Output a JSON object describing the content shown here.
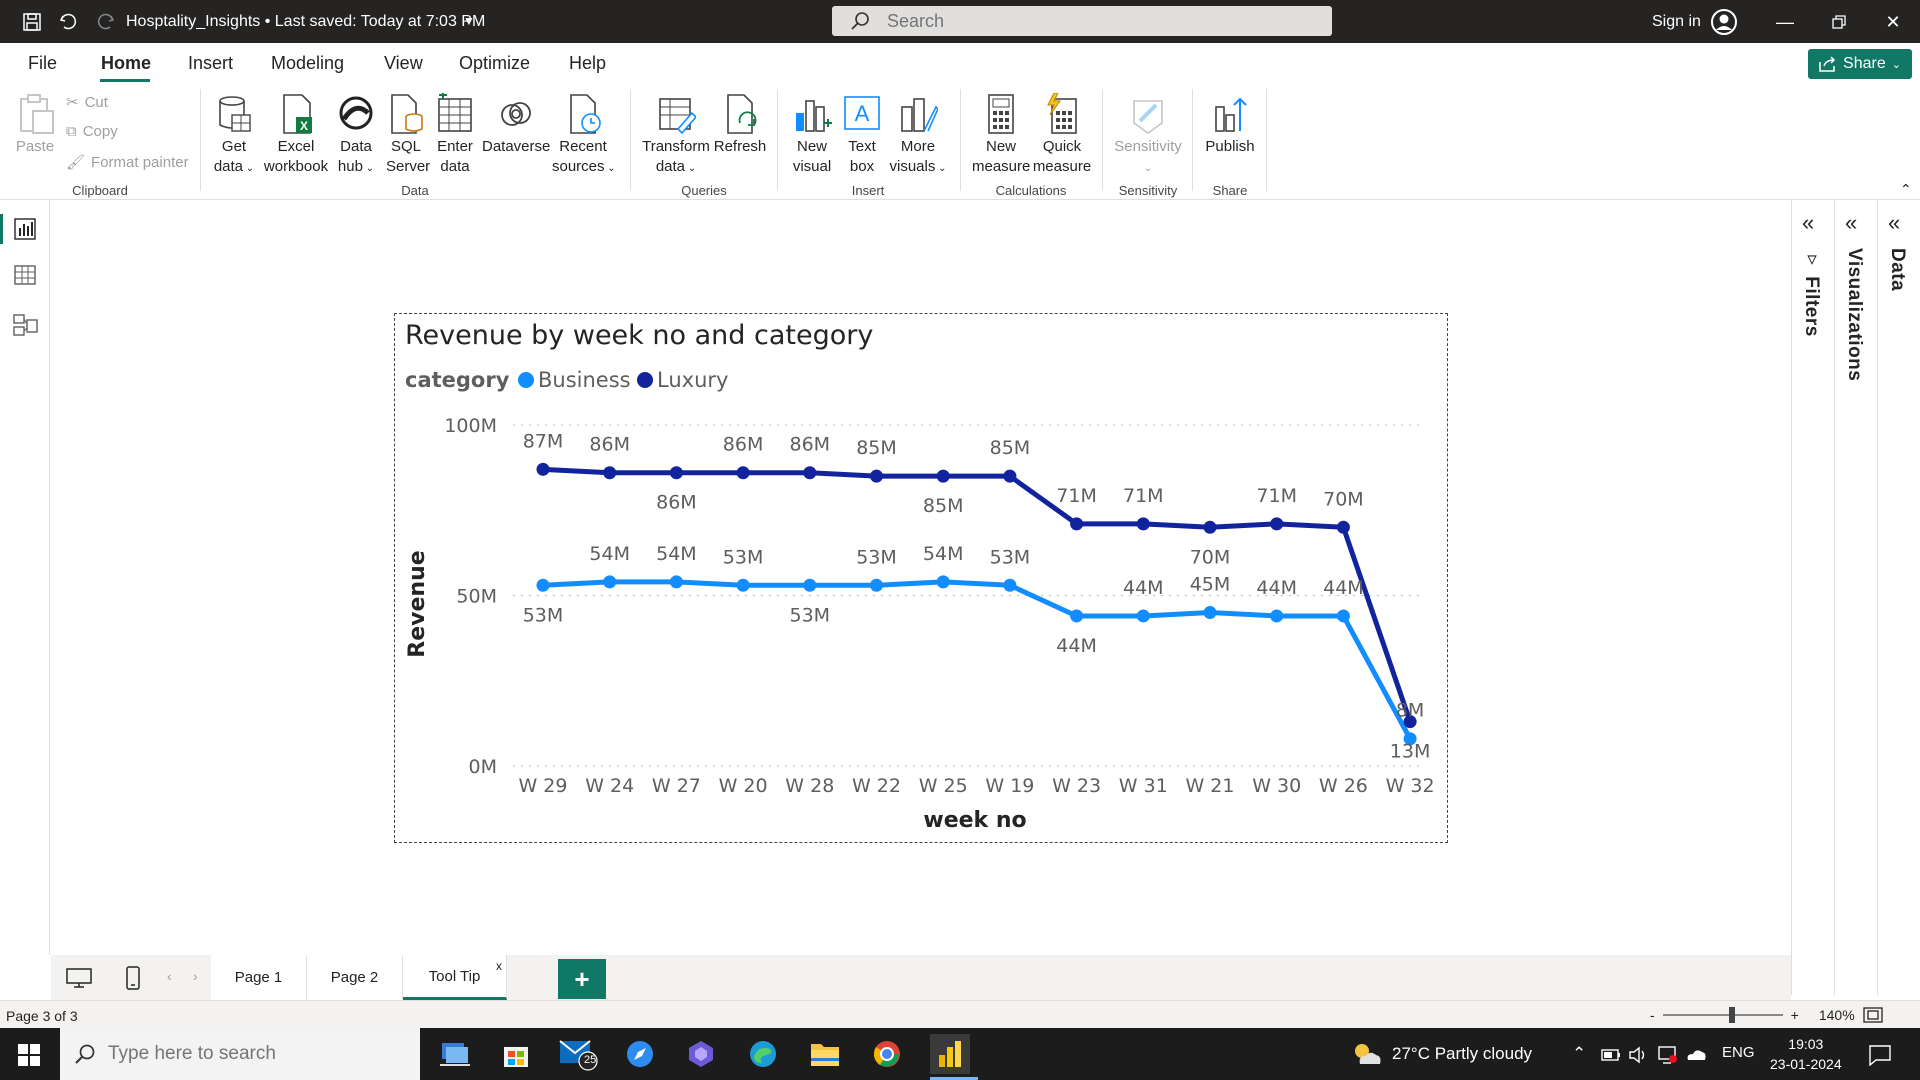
{
  "titlebar": {
    "file_title": "Hosptality_Insights • Last saved: Today at 7:03 PM",
    "search_placeholder": "Search",
    "signin": "Sign in"
  },
  "menu": {
    "tabs": [
      "File",
      "Home",
      "Insert",
      "Modeling",
      "View",
      "Optimize",
      "Help"
    ],
    "active": "Home",
    "share": "Share"
  },
  "ribbon": {
    "clipboard": {
      "paste": "Paste",
      "cut": "Cut",
      "copy": "Copy",
      "format_painter": "Format painter",
      "label": "Clipboard"
    },
    "data": {
      "get_data": [
        "Get",
        "data"
      ],
      "excel": [
        "Excel",
        "workbook"
      ],
      "data_hub": [
        "Data",
        "hub"
      ],
      "sql": [
        "SQL",
        "Server"
      ],
      "enter_data": [
        "Enter",
        "data"
      ],
      "dataverse": "Dataverse",
      "recent": [
        "Recent",
        "sources"
      ],
      "label": "Data"
    },
    "queries": {
      "transform": [
        "Transform",
        "data"
      ],
      "refresh": "Refresh",
      "label": "Queries"
    },
    "insert": {
      "new_visual": [
        "New",
        "visual"
      ],
      "text_box": [
        "Text",
        "box"
      ],
      "more_visuals": [
        "More",
        "visuals"
      ],
      "label": "Insert"
    },
    "calculations": {
      "new_measure": [
        "New",
        "measure"
      ],
      "quick_measure": [
        "Quick",
        "measure"
      ],
      "label": "Calculations"
    },
    "sensitivity": {
      "button": "Sensitivity",
      "label": "Sensitivity"
    },
    "share": {
      "publish": "Publish",
      "label": "Share"
    }
  },
  "panes": {
    "filters": "Filters",
    "visualizations": "Visualizations",
    "data": "Data"
  },
  "pages": {
    "tabs": [
      "Page 1",
      "Page 2",
      "Tool Tip"
    ],
    "active": "Tool Tip",
    "close": "x",
    "add": "+"
  },
  "status": {
    "page_text": "Page 3 of 3",
    "zoom": "140%",
    "zoom_minus": "-",
    "zoom_plus": "+"
  },
  "taskbar": {
    "search_placeholder": "Type here to search",
    "mail_badge": "25",
    "weather": "27°C  Partly cloudy",
    "lang": "ENG",
    "time": "19:03",
    "date": "23-01-2024"
  },
  "colors": {
    "accent": "#117865",
    "business": "#118dff",
    "luxury": "#12239e"
  },
  "chart_data": {
    "type": "line",
    "title": "Revenue by week no and category",
    "legend_title": "category",
    "legend_position": "top-left",
    "xlabel": "week no",
    "ylabel": "Revenue",
    "ylim": [
      0,
      100
    ],
    "y_ticks": [
      "0M",
      "50M",
      "100M"
    ],
    "categories": [
      "W 29",
      "W 24",
      "W 27",
      "W 20",
      "W 28",
      "W 22",
      "W 25",
      "W 19",
      "W 23",
      "W 31",
      "W 21",
      "W 30",
      "W 26",
      "W 32"
    ],
    "series": [
      {
        "name": "Business",
        "color": "#118dff",
        "values": [
          53,
          54,
          54,
          53,
          53,
          53,
          54,
          53,
          44,
          44,
          45,
          44,
          44,
          8
        ],
        "labels": [
          "53M",
          "54M",
          "54M",
          "53M",
          "53M",
          "53M",
          "54M",
          "53M",
          "44M",
          "44M",
          "45M",
          "44M",
          "44M",
          "8M"
        ]
      },
      {
        "name": "Luxury",
        "color": "#12239e",
        "values": [
          87,
          86,
          86,
          86,
          86,
          85,
          85,
          85,
          71,
          71,
          70,
          71,
          70,
          13
        ],
        "labels": [
          "87M",
          "86M",
          "86M",
          "86M",
          "86M",
          "85M",
          "85M",
          "85M",
          "71M",
          "71M",
          "70M",
          "71M",
          "70M",
          "13M"
        ]
      }
    ],
    "grid": true
  }
}
